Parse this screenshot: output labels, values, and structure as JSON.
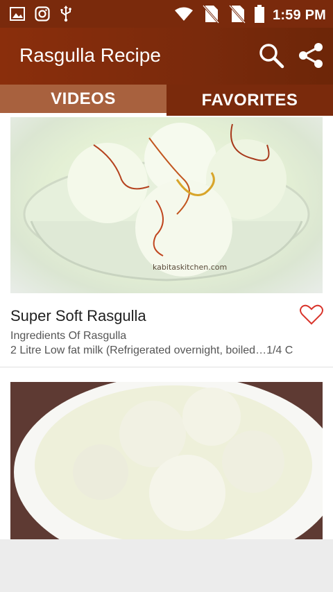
{
  "status_bar": {
    "time": "1:59 PM",
    "left_icons": [
      "image-icon",
      "instagram-icon",
      "usb-icon"
    ],
    "right_icons": [
      "wifi-icon",
      "no-sim-icon",
      "no-sim-icon-2",
      "battery-icon"
    ]
  },
  "toolbar": {
    "title": "Rasgulla Recipe",
    "icons": [
      "search-icon",
      "share-icon"
    ]
  },
  "tabs": [
    {
      "label": "VIDEOS",
      "active": true
    },
    {
      "label": "FAVORITES",
      "active": false
    }
  ],
  "recipes": [
    {
      "title": "Super Soft Rasgulla",
      "subtitle": "Ingredients Of Rasgulla",
      "description": "2 Litre Low fat milk (Refrigerated overnight, boiled…1/4 C",
      "image_watermark": "kabitaskitchen.com",
      "favorite": false
    },
    {
      "title": "",
      "favorite": false
    }
  ],
  "colors": {
    "status_bar": "#7a2a0c",
    "toolbar": "#7a2a0c",
    "tab_active": "#a8613e",
    "tab_inactive": "#7a2a0c",
    "heart": "#d9342b"
  }
}
